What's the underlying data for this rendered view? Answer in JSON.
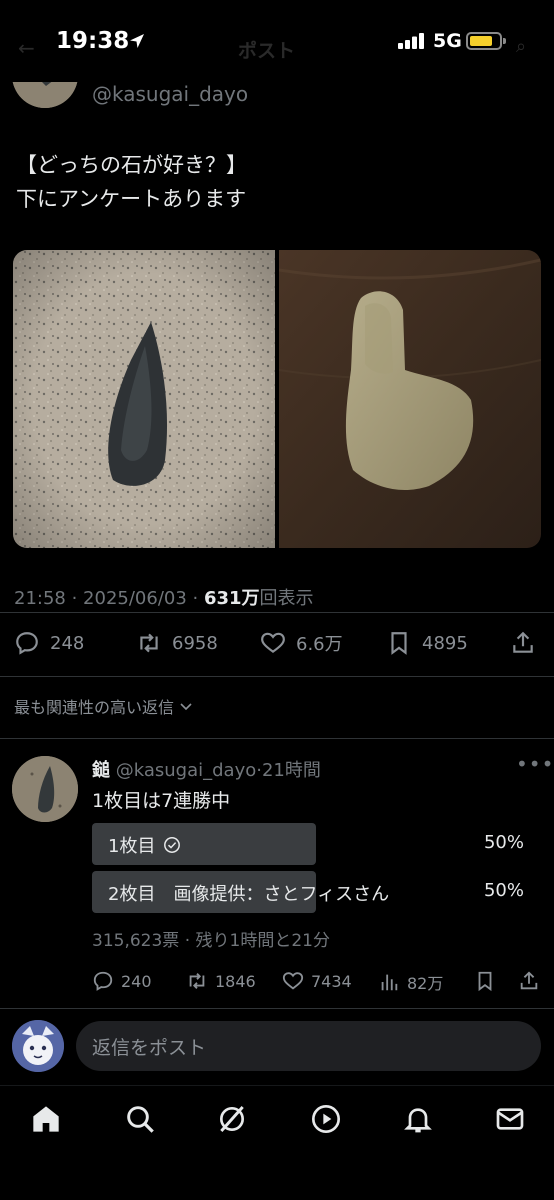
{
  "status_bar": {
    "time": "19:38",
    "network": "5G",
    "faded_title": "ポスト"
  },
  "tweet": {
    "handle": "@kasugai_dayo",
    "text_line1": "【どっちの石が好き？】",
    "text_line2": "下にアンケートあります",
    "time": "21:58",
    "date": "2025/06/03",
    "views_number": "631万",
    "views_label": "回表示",
    "replies": "248",
    "retweets": "6958",
    "likes": "6.6万",
    "bookmarks": "4895"
  },
  "replies_sort": {
    "label": "最も関連性の高い返信"
  },
  "reply": {
    "name": "鎚",
    "handle": "@kasugai_dayo",
    "age": "21時間",
    "text": "1枚目は7連勝中",
    "poll": {
      "options": [
        {
          "label": "1枚目",
          "percent": "50%",
          "share": 0.5,
          "selected": true
        },
        {
          "label": "2枚目　画像提供：さとフィスさん",
          "percent": "50%",
          "share": 0.5,
          "selected": false
        }
      ],
      "votes": "315,623票",
      "remaining": "残り1時間と21分"
    },
    "replies": "240",
    "retweets": "1846",
    "likes": "7434",
    "views": "82万"
  },
  "compose": {
    "placeholder": "返信をポスト"
  },
  "nav": {
    "items": [
      "home-icon",
      "search-icon",
      "grok-icon",
      "video-icon",
      "notifications-icon",
      "messages-icon"
    ]
  }
}
